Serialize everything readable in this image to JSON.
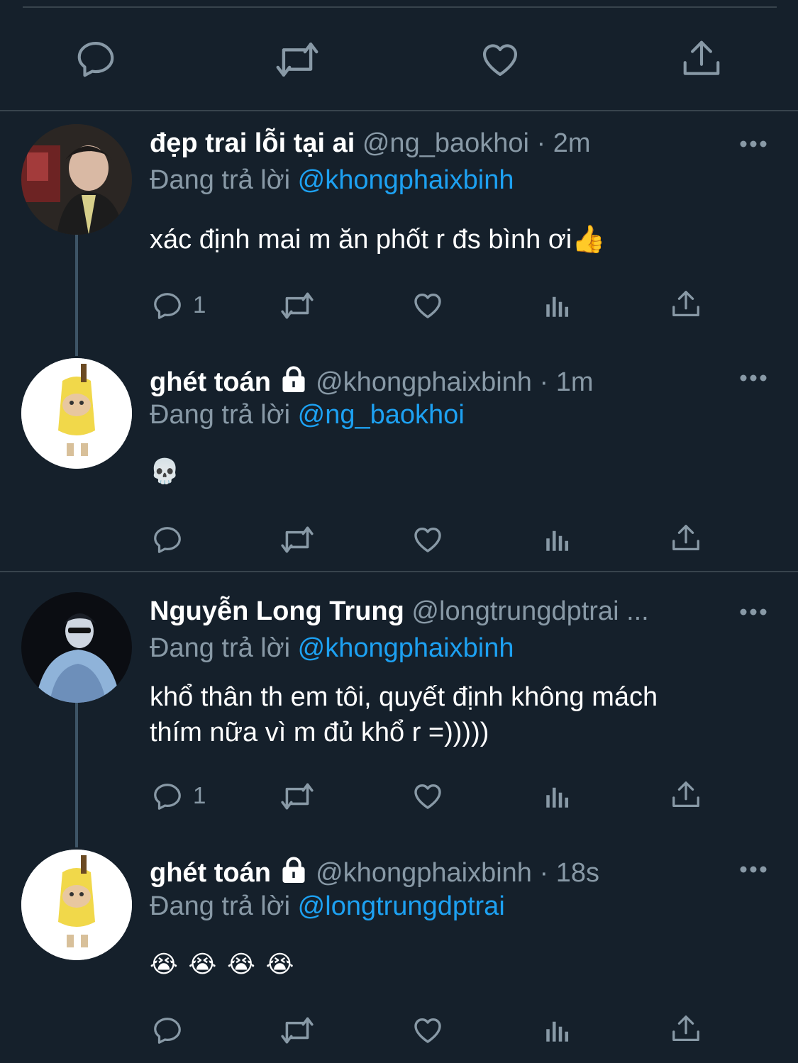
{
  "top_actions": [
    {
      "icon": "reply-icon"
    },
    {
      "icon": "retweet-icon"
    },
    {
      "icon": "like-icon"
    },
    {
      "icon": "share-icon"
    }
  ],
  "tweets": [
    {
      "name": "đẹp trai lỗi tại ai",
      "handle": "@ng_baokhoi",
      "time": "· 2m",
      "reply_prefix": "Đang trả lời",
      "reply_to": "@khongphaixbinh",
      "text": "xác định mai m ăn phốt r đs bình ơi👍",
      "reply_count": "1"
    },
    {
      "name": "ghét toán",
      "locked": true,
      "handle": "@khongphaixbinh",
      "time": "· 1m",
      "reply_prefix": "Đang trả lời",
      "reply_to": "@ng_baokhoi",
      "text": "💀",
      "reply_count": ""
    },
    {
      "name": "Nguyễn Long Trung",
      "handle": "@longtrungdptrai ...",
      "time": "",
      "reply_prefix": "Đang trả lời",
      "reply_to": "@khongphaixbinh",
      "text_lines": [
        "khổ thân th em tôi, quyết định không mách",
        "thím nữa vì m đủ khổ r =)))))"
      ],
      "reply_count": "1"
    },
    {
      "name": "ghét toán",
      "locked": true,
      "handle": "@khongphaixbinh",
      "time": "· 18s",
      "reply_prefix": "Đang trả lời",
      "reply_to": "@longtrungdptrai",
      "text": "😭 😭 😭 😭",
      "reply_count": ""
    }
  ],
  "icons": {
    "more": "more-icon",
    "lock": "lock-icon",
    "analytics": "analytics-icon"
  },
  "colors": {
    "background": "#15202b",
    "muted": "#8899a6",
    "link": "#1da1f2",
    "divider": "#38444d"
  }
}
